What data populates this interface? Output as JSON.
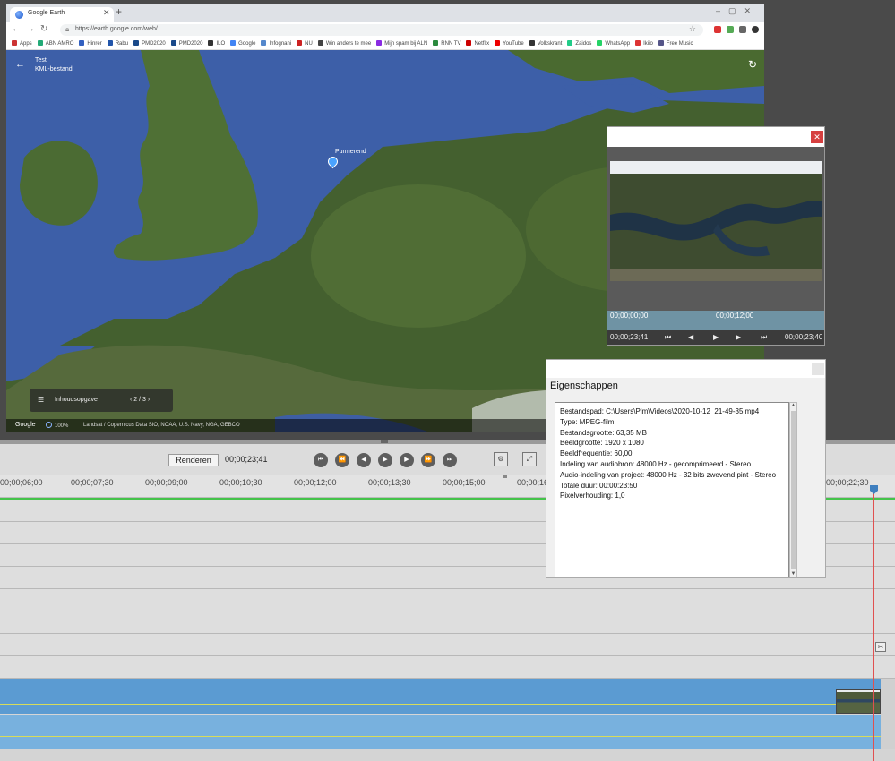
{
  "browser": {
    "tab_title": "Google Earth",
    "url": "https://earth.google.com/web/",
    "bookmarks": [
      "Apps",
      "ABN AMRO",
      "Hinrer",
      "Rabu",
      "PMD2020",
      "PMD2020",
      "ILO",
      "Google",
      "Infognani",
      "NU",
      "Win anders te mee",
      "Mijn spam bij ALN",
      "RNN TV",
      "Netflix",
      "YouTube",
      "Volkskrant",
      "Zaidos",
      "WhatsApp",
      "Ikiio",
      "Free Music"
    ]
  },
  "earth": {
    "panel_title": "Test",
    "panel_subtitle": "KML-bestand",
    "placemark": "Purmerend",
    "toc_label": "Inhoudsopgave",
    "toc_pager": "2 / 3",
    "google_logo": "Google",
    "scale": "100%",
    "credits": "Landsat / Copernicus  Data SIO, NOAA, U.S. Navy, NGA, GEBCO"
  },
  "transport": {
    "render_label": "Renderen",
    "timecode": "00;00;23;41"
  },
  "ruler": {
    "ticks": [
      "00;00;06;00",
      "00;00;07;30",
      "00;00;09;00",
      "00;00;10;30",
      "00;00;12;00",
      "00;00;13;30",
      "00;00;15;00",
      "00;00;16",
      "00;00;22;30"
    ]
  },
  "preview": {
    "scrub_start": "00;00;00;00",
    "scrub_mid": "00;00;12;00",
    "current_tc": "00;00;23;41",
    "end_tc": "00;00;23;40"
  },
  "properties": {
    "title": "Eigenschappen",
    "lines": [
      "Bestandspad: C:\\Users\\Plm\\Videos\\2020-10-12_21-49-35.mp4",
      "Type: MPEG-film",
      "Bestandsgrootte: 63,35 MB",
      "Beeldgrootte: 1920 x 1080",
      "Beeldfrequentie: 60,00",
      "Indeling van audiobron: 48000  Hz - gecomprimeerd - Stereo",
      "Audio-indeling van project: 48000  Hz - 32 bits zwevend pint - Stereo",
      "Totale duur: 00:00:23:50",
      "Pixelverhouding: 1,0"
    ]
  },
  "colors": {
    "clip_blue": "#5b9bd2",
    "clip_blue_light": "#78b1de",
    "timeline_green": "#44c34a",
    "playhead_red": "#e05050",
    "close_red": "#d64040"
  }
}
